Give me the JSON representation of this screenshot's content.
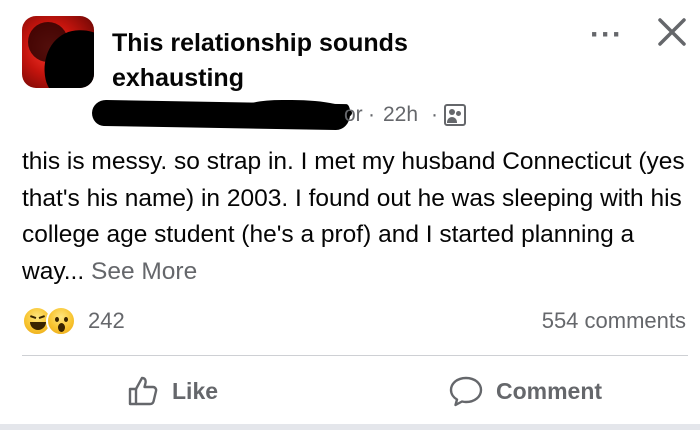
{
  "post": {
    "group_name": "This relationship sounds exhausting",
    "author_fragment": "or",
    "meta_separator": "·",
    "time": "22h",
    "body_text": "this is messy. so strap in. I met my husband Connecticut (yes that's his name) in 2003. I found out he was sleeping with his college age student (he's a prof) and I started planning a way...",
    "see_more_label": "See More",
    "more_icon_text": "···"
  },
  "engagement": {
    "reaction_count": "242",
    "comments_label": "554 comments",
    "reactions": [
      "haha",
      "wow"
    ]
  },
  "actions": {
    "like_label": "Like",
    "comment_label": "Comment"
  },
  "colors": {
    "primary_text": "#050505",
    "secondary_text": "#65676b",
    "divider": "#ced0d4"
  },
  "icons": {
    "more": "more-options-icon",
    "close": "close-icon",
    "audience": "group-audience-icon",
    "like": "thumbs-up-icon",
    "comment": "speech-bubble-icon"
  }
}
